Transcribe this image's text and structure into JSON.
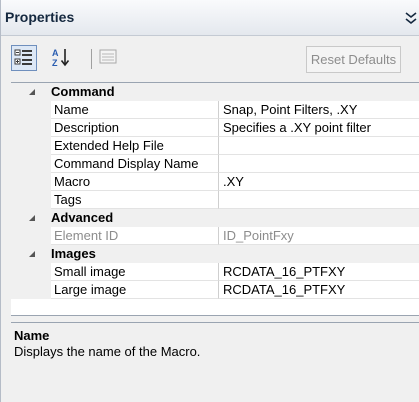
{
  "panel": {
    "title": "Properties"
  },
  "toolbar": {
    "categorized_icon": "categorized-icon",
    "alphabetical_icon": "alphabetical-icon",
    "property_pages_icon": "property-pages-icon",
    "reset_label": "Reset Defaults"
  },
  "grid": {
    "categories": [
      {
        "label": "Command",
        "rows": [
          {
            "name": "Name",
            "value": "Snap, Point Filters, .XY"
          },
          {
            "name": "Description",
            "value": "Specifies a .XY point filter"
          },
          {
            "name": "Extended Help File",
            "value": ""
          },
          {
            "name": "Command Display Name",
            "value": ""
          },
          {
            "name": "Macro",
            "value": ".XY"
          },
          {
            "name": "Tags",
            "value": ""
          }
        ]
      },
      {
        "label": "Advanced",
        "rows": [
          {
            "name": "Element ID",
            "value": "ID_PointFxy"
          }
        ]
      },
      {
        "label": "Images",
        "rows": [
          {
            "name": "Small image",
            "value": "RCDATA_16_PTFXY"
          },
          {
            "name": "Large image",
            "value": "RCDATA_16_PTFXY"
          }
        ]
      }
    ]
  },
  "description": {
    "title": "Name",
    "text": "Displays the name of the Macro."
  }
}
